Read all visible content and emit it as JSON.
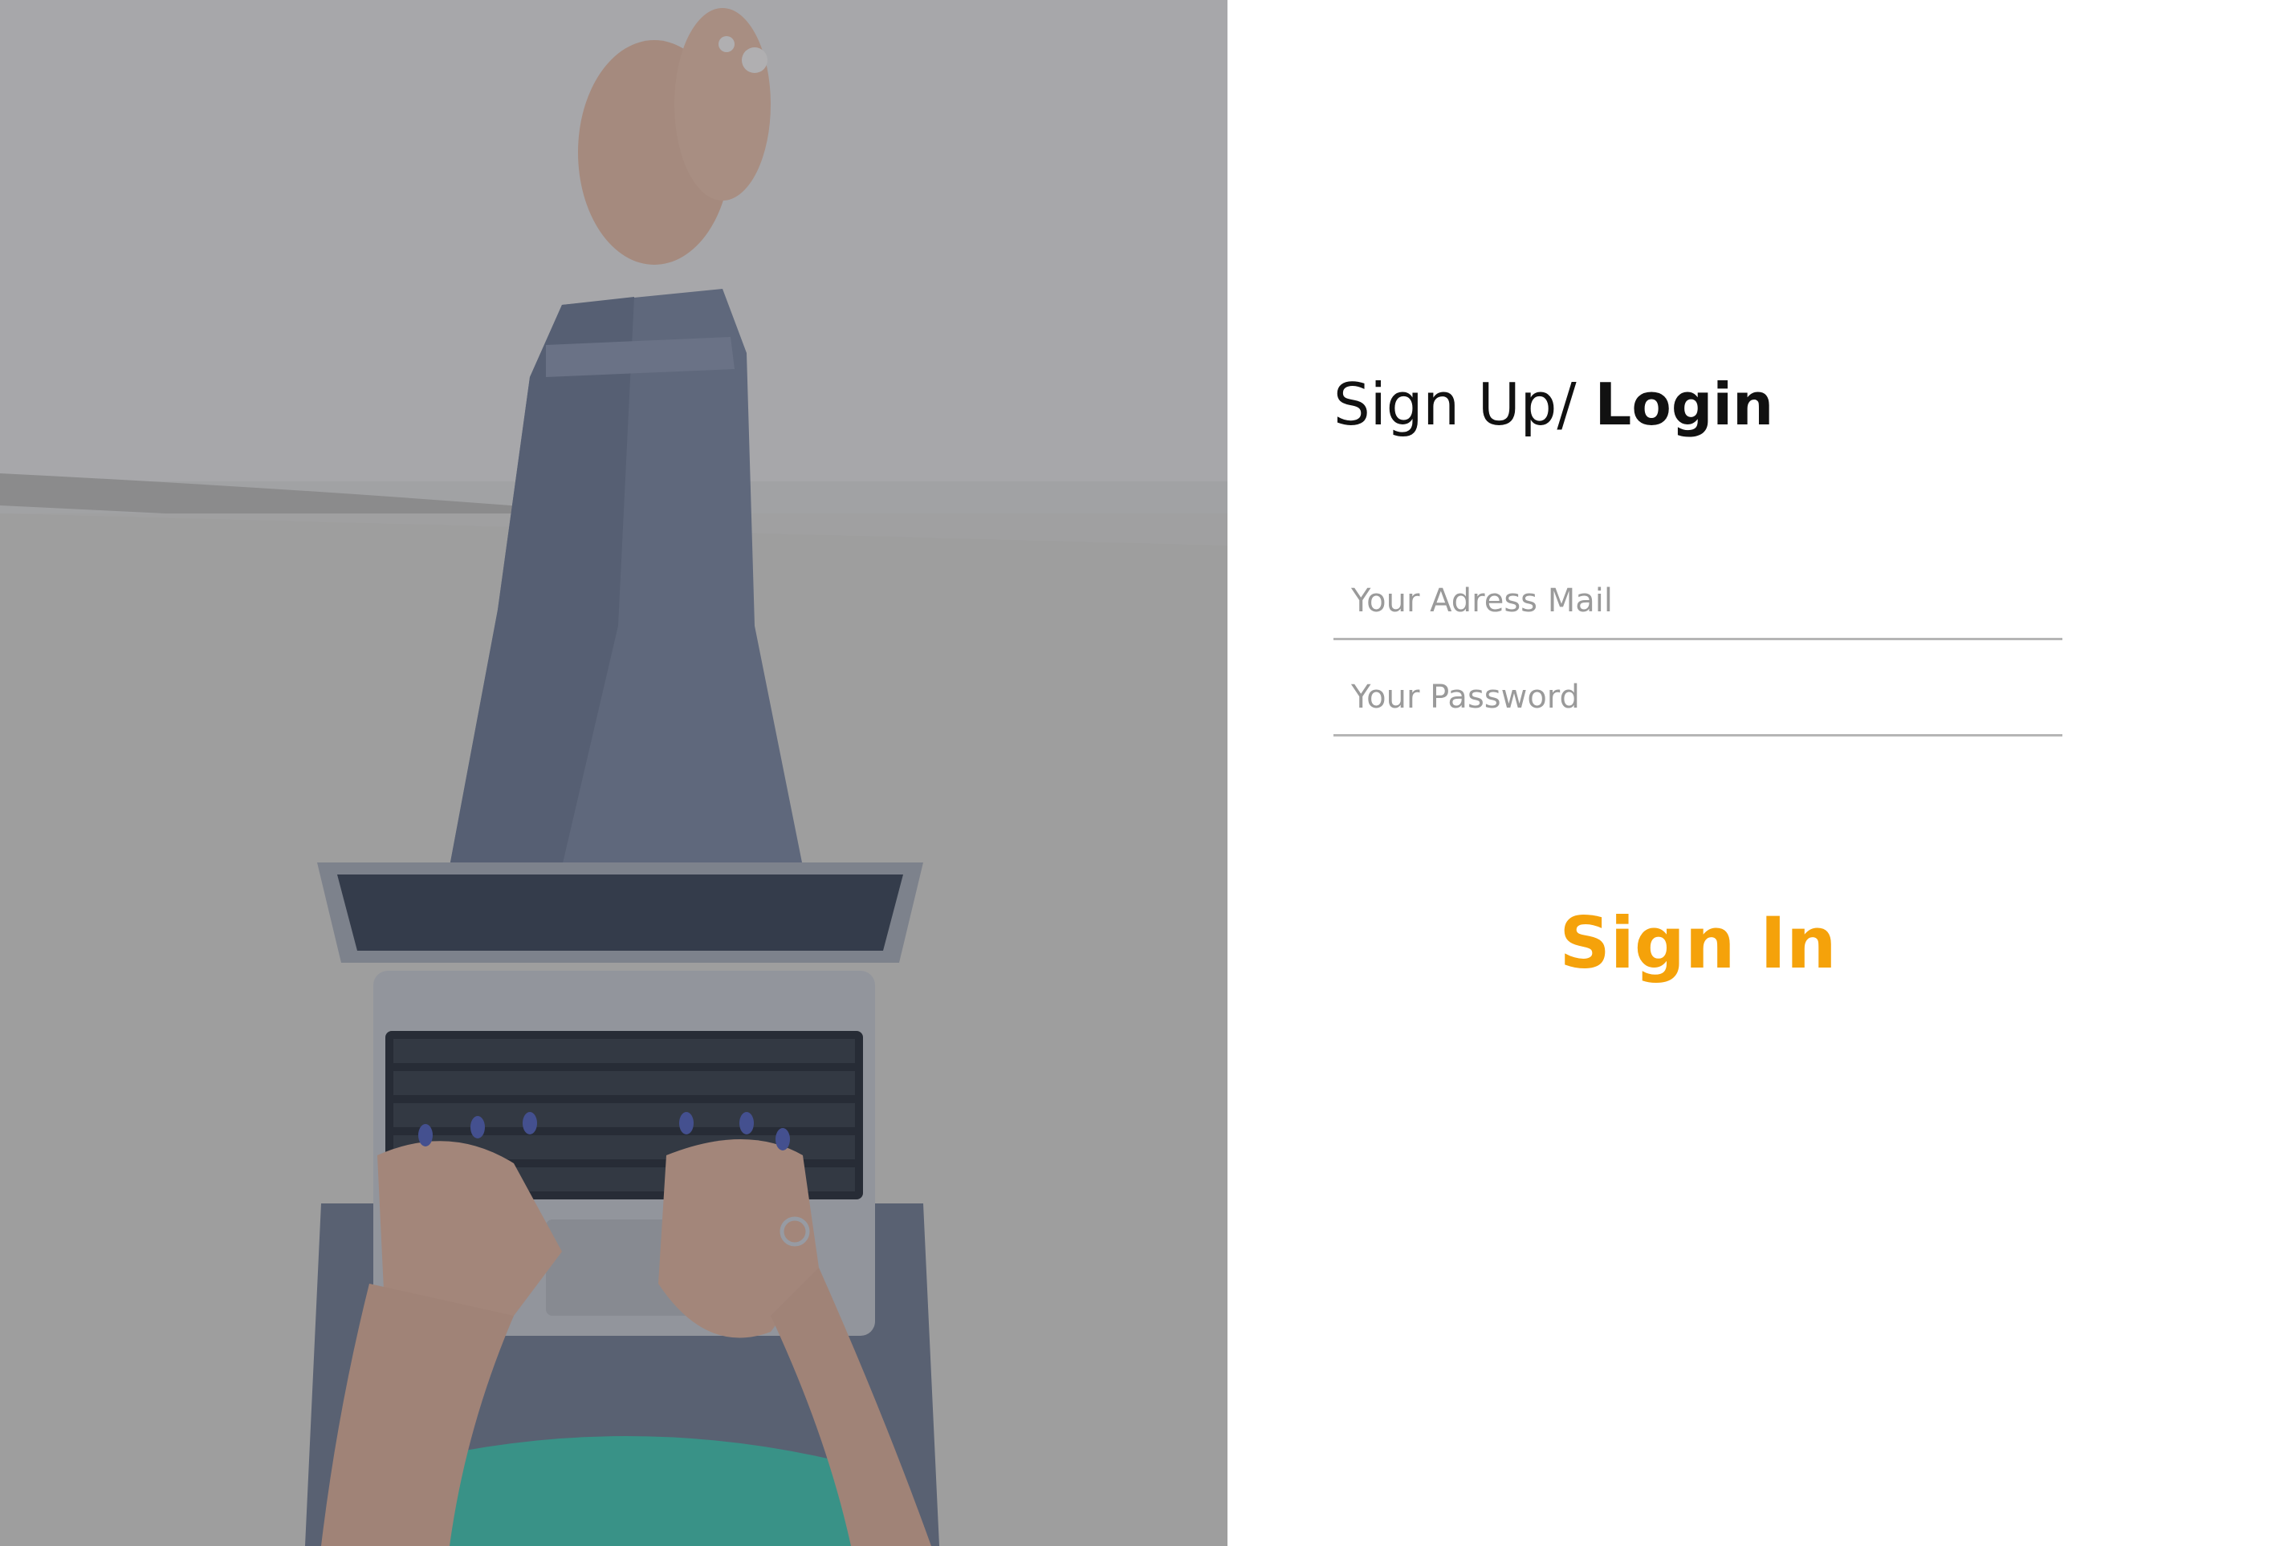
{
  "hero": {
    "image_description_icon": "woman-typing-on-laptop-photo"
  },
  "form": {
    "heading_regular": "Sign Up/ ",
    "heading_bold": "Login",
    "email_placeholder": "Your Adress Mail",
    "email_value": "",
    "password_placeholder": "Your Password",
    "password_value": "",
    "submit_label": "Sign In"
  },
  "colors": {
    "accent": "#f5a20a",
    "field_underline": "#b5b5b5",
    "placeholder": "#9a9a9a",
    "heading": "#111111",
    "background": "#ffffff"
  }
}
